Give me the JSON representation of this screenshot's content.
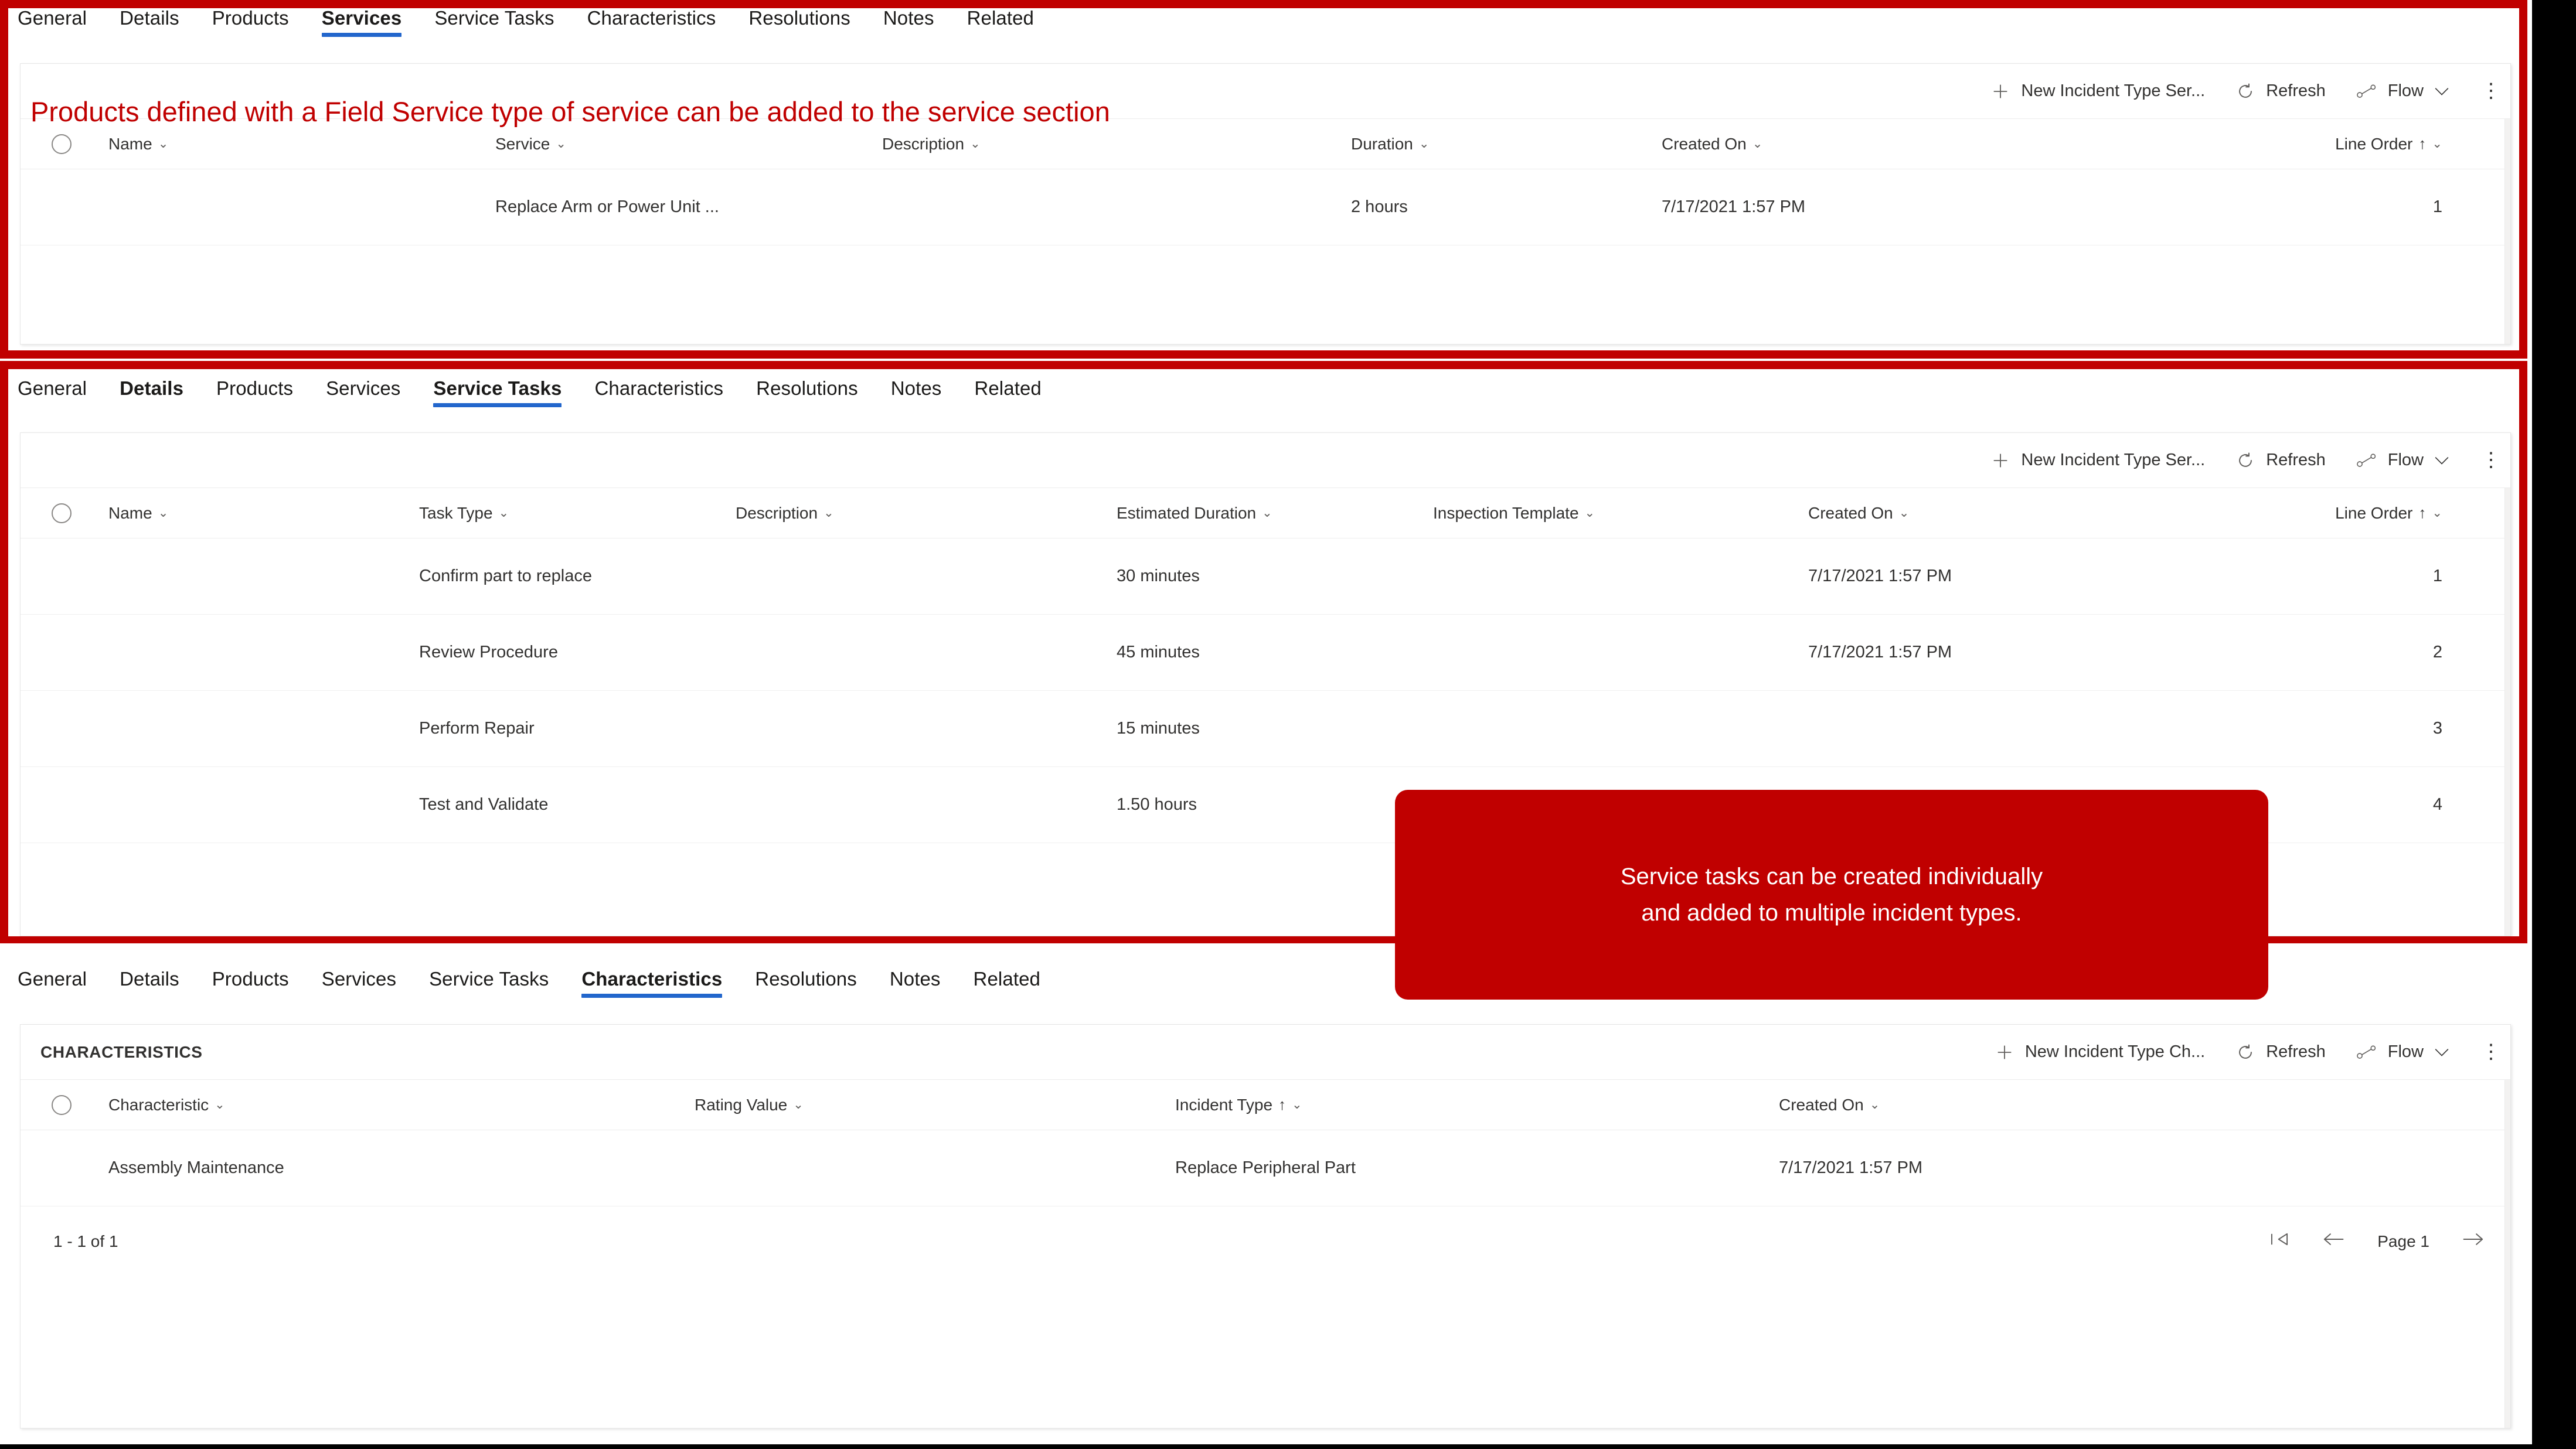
{
  "colors": {
    "annotation_red": "#c00000",
    "link_blue": "#2266cc",
    "tab_underline": "#2266cc",
    "backdrop_black": "#000000",
    "text": "#323130"
  },
  "tabs": [
    "General",
    "Details",
    "Products",
    "Services",
    "Service Tasks",
    "Characteristics",
    "Resolutions",
    "Notes",
    "Related"
  ],
  "annotations": {
    "services_note": "Products defined with a Field Service type of service can be added to the service section",
    "callout_line1": "Service tasks can be created individually",
    "callout_line2": "and added to multiple incident types."
  },
  "toolbar": {
    "plus_icon": "add-icon",
    "refresh_icon": "refresh-icon",
    "flow_icon": "flow-icon",
    "refresh_label": "Refresh",
    "flow_label": "Flow",
    "flow_chevron": "chevron-down-icon",
    "overflow_label": "more-commands-icon"
  },
  "panels": [
    {
      "id": "services",
      "active_tab": "Services",
      "new_label": "New Incident Type Ser...",
      "grid_title": "",
      "columns": [
        "Name",
        "Service",
        "Description",
        "Duration",
        "Created On",
        "Line Order"
      ],
      "sorted_column": "Line Order",
      "sort_direction": "ascending",
      "rows": [
        {
          "name": "",
          "service": "Replace Arm or Power Unit ...",
          "description": "",
          "duration": "2 hours",
          "created_on": "7/17/2021 1:57 PM",
          "line_order": "1"
        }
      ]
    },
    {
      "id": "service-tasks",
      "active_tab": "Service Tasks",
      "new_label": "New Incident Type Ser...",
      "grid_title": "",
      "columns": [
        "Name",
        "Task Type",
        "Description",
        "Estimated Duration",
        "Inspection Template",
        "Created On",
        "Line Order"
      ],
      "sorted_column": "Line Order",
      "sort_direction": "ascending",
      "rows": [
        {
          "name": "",
          "task_type": "Confirm part to replace",
          "description": "",
          "estimated_duration": "30 minutes",
          "inspection_template": "",
          "created_on": "7/17/2021 1:57 PM",
          "line_order": "1"
        },
        {
          "name": "",
          "task_type": "Review Procedure",
          "description": "",
          "estimated_duration": "45 minutes",
          "inspection_template": "",
          "created_on": "7/17/2021 1:57 PM",
          "line_order": "2"
        },
        {
          "name": "",
          "task_type": "Perform Repair",
          "description": "",
          "estimated_duration": "15 minutes",
          "inspection_template": "",
          "created_on": "",
          "line_order": "3"
        },
        {
          "name": "",
          "task_type": "Test and Validate",
          "description": "",
          "estimated_duration": "1.50 hours",
          "inspection_template": "",
          "created_on": "",
          "line_order": "4"
        }
      ]
    },
    {
      "id": "characteristics",
      "active_tab": "Characteristics",
      "new_label": "New Incident Type Ch...",
      "grid_title": "CHARACTERISTICS",
      "columns": [
        "Characteristic",
        "Rating Value",
        "Incident Type",
        "Created On"
      ],
      "sorted_column": "Incident Type",
      "sort_direction": "ascending",
      "rows": [
        {
          "characteristic": "Assembly Maintenance",
          "rating_value": "",
          "incident_type": "Replace Peripheral Part",
          "created_on": "7/17/2021 1:57 PM"
        }
      ],
      "pager": {
        "count_label": "1 - 1 of 1",
        "first_icon": "first-page-icon",
        "prev_icon": "previous-page-icon",
        "page_label": "Page 1",
        "next_icon": "next-page-icon"
      }
    }
  ]
}
